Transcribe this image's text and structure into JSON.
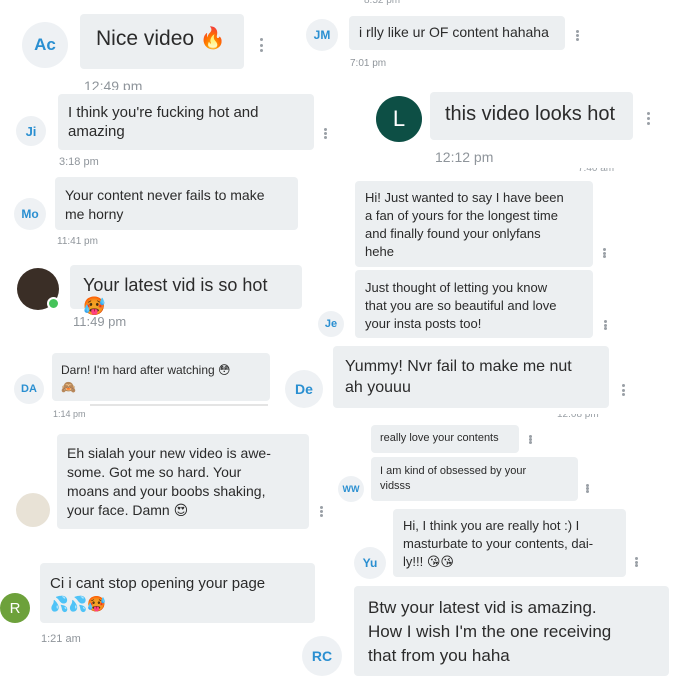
{
  "messages": [
    {
      "id": "m1",
      "avatar": "Ac",
      "text": "Nice video 🔥",
      "time": "12:49 pm"
    },
    {
      "id": "m2",
      "avatar": "Ji",
      "text": "I think you're fucking hot and\namazing",
      "time": "3:18 pm"
    },
    {
      "id": "m3",
      "avatar": "Mo",
      "text": "Your content never fails to make\nme horny",
      "time": "11:41 pm"
    },
    {
      "id": "m4",
      "avatar": "",
      "text": "Your latest vid is so hot 🥵",
      "time": "11:49 pm"
    },
    {
      "id": "m5",
      "avatar": "DA",
      "text": "Darn! I'm hard after watching 😳\n🙈",
      "time": "1:14 pm"
    },
    {
      "id": "m6",
      "avatar": "",
      "text": "Eh sialah your new video is awe-\nsome. Got me so hard. Your\nmoans and your boobs shaking,\nyour face. Damn 😍",
      "time": ""
    },
    {
      "id": "m7",
      "avatar": "R",
      "text": "Ci i cant stop opening your page\n💦💦🥵",
      "time": "1:21 am"
    },
    {
      "id": "m8",
      "avatar": "JM",
      "text": "i rlly like ur OF content hahaha",
      "time": "7:01 pm"
    },
    {
      "id": "m9",
      "avatar": "L",
      "text": "this video looks hot",
      "time": "12:12 pm"
    },
    {
      "id": "m10",
      "avatar": "",
      "text": "Hi! Just wanted to say I have been\na fan of yours for the longest time\nand finally found your onlyfans\nhehe",
      "time": ""
    },
    {
      "id": "m11",
      "avatar": "Je",
      "text": "Just thought of letting you know\nthat you are so beautiful and love\nyour insta posts too!",
      "time": ""
    },
    {
      "id": "m12",
      "avatar": "De",
      "text": "Yummy! Nvr fail to make me nut\nah youuu",
      "time": ""
    },
    {
      "id": "m13",
      "avatar": "",
      "text": "really love your contents",
      "time": ""
    },
    {
      "id": "m14",
      "avatar": "WW",
      "text": "I am kind of obsessed by your\nvidsss",
      "time": ""
    },
    {
      "id": "m15",
      "avatar": "Yu",
      "text": "Hi, I think you are really hot :) I\nmasturbate to your contents, dai-\nly!!! 😘😘",
      "time": ""
    },
    {
      "id": "m16",
      "avatar": "RC",
      "text": "Btw your latest vid is amazing.\nHow I wish I'm the one receiving\nthat from you haha",
      "time": ""
    }
  ],
  "icons": {
    "more": "more-vert-icon",
    "online": "online-status-icon"
  }
}
